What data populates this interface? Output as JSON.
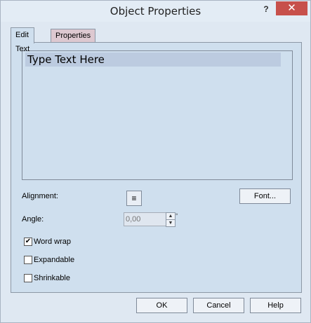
{
  "window": {
    "title": "Object Properties",
    "help_label": "?",
    "close_label": "✕"
  },
  "tabs": [
    {
      "label": "Edit Text",
      "active": true
    },
    {
      "label": "Properties",
      "active": false
    }
  ],
  "edit_text": {
    "text_value": "Type Text Here",
    "alignment_label": "Alignment:",
    "alignment_icon": "align-left-icon",
    "font_button": "Font...",
    "angle_label": "Angle:",
    "angle_value": "0,00",
    "degree_symbol": "°",
    "options": [
      {
        "label": "Word wrap",
        "checked": true
      },
      {
        "label": "Expandable",
        "checked": false
      },
      {
        "label": "Shrinkable",
        "checked": false
      }
    ]
  },
  "footer": {
    "ok": "OK",
    "cancel": "Cancel",
    "help": "Help"
  }
}
